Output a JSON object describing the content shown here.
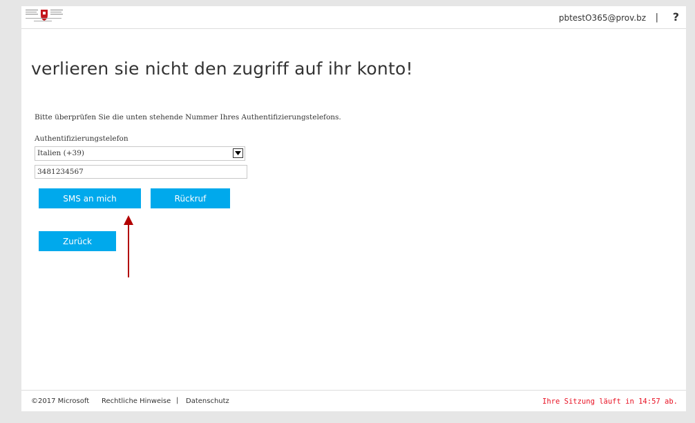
{
  "header": {
    "user_email": "pbtestO365@prov.bz",
    "separator": "|",
    "help_label": "?"
  },
  "main": {
    "title": "verlieren sie nicht den zugriff auf ihr konto!",
    "instruction": "Bitte überprüfen Sie die unten stehende Nummer Ihres Authentifizierungstelefons.",
    "phone_label": "Authentifizierungstelefon",
    "country_selected": "Italien (+39)",
    "phone_number": "3481234567",
    "sms_button": "SMS an mich",
    "callback_button": "Rückruf",
    "back_button": "Zurück"
  },
  "footer": {
    "copyright": "©2017 Microsoft",
    "legal": "Rechtliche Hinweise",
    "separator": "|",
    "privacy": "Datenschutz",
    "session": "Ihre Sitzung läuft in 14:57 ab."
  },
  "colors": {
    "accent_button": "#00a9ec",
    "annotation_arrow": "#b20000",
    "session_warning": "#e81123"
  }
}
